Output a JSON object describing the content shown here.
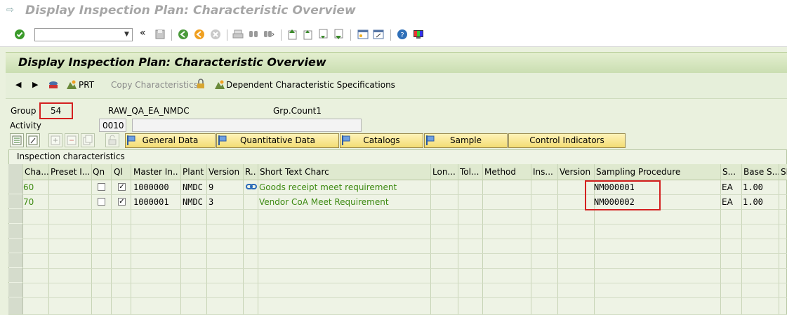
{
  "window": {
    "title": "Display Inspection Plan: Characteristic Overview"
  },
  "toolbar": {
    "command_value": "",
    "nav_back_glyph": "«"
  },
  "page": {
    "title": "Display Inspection Plan: Characteristic Overview"
  },
  "app_toolbar": {
    "prt_label": "PRT",
    "copy_char_label": "Copy Characteristics",
    "dependent_label": "Dependent Characteristic Specifications"
  },
  "header_fields": {
    "group_label": "Group",
    "group_value": "54",
    "group_name": "RAW_QA_EA_NMDC",
    "grp_count_label": "Grp.Count1",
    "activity_label": "Activity",
    "activity_value": "0010",
    "activity_text": ""
  },
  "tabs": [
    "General Data",
    "Quantitative Data",
    "Catalogs",
    "Sample",
    "Control Indicators"
  ],
  "table": {
    "title": "Inspection characteristics",
    "columns": [
      "Cha...",
      "Preset I...",
      "Qn",
      "Ql",
      "Master In...",
      "Plant",
      "Version",
      "R..",
      "Short Text Charc",
      "Lon...",
      "Tol...",
      "Method",
      "Ins...",
      "Version",
      "Sampling Procedure",
      "S...",
      "Base S...",
      "SP"
    ],
    "rows": [
      {
        "char": "60",
        "preset": "",
        "qn": false,
        "ql": true,
        "master": "1000000",
        "plant": "NMDC",
        "version": "9",
        "ref_icon": "link-icon",
        "short_text": "Goods receipt meet requirement",
        "sampling": "NM000001",
        "unit": "EA",
        "base": "1.00"
      },
      {
        "char": "70",
        "preset": "",
        "qn": false,
        "ql": true,
        "master": "1000001",
        "plant": "NMDC",
        "version": "3",
        "ref_icon": "",
        "short_text": "Vendor CoA Meet Requirement",
        "sampling": "NM000002",
        "unit": "EA",
        "base": "1.00"
      }
    ]
  },
  "colors": {
    "accent_red": "#d42020",
    "green_text": "#3d8a12",
    "tab_yellow": "#f3dd74",
    "header_green": "#c9ddb0"
  }
}
